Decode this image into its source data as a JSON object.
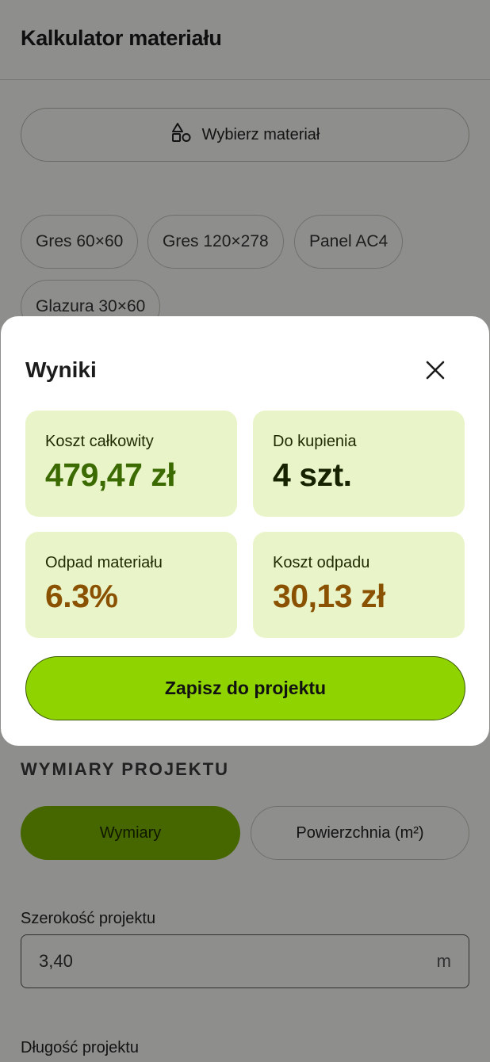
{
  "appbar": {
    "title": "Kalkulator materiału"
  },
  "material_button": {
    "label": "Wybierz materiał",
    "icon": "shapes-icon"
  },
  "chips": [
    "Gres 60×60",
    "Gres 120×278",
    "Panel AC4",
    "Glazura 30×60"
  ],
  "dimensions": {
    "section_title": "WYMIARY PROJEKTU",
    "modes": [
      "Wymiary",
      "Powierzchnia (m²)"
    ],
    "width_label": "Szerokość projektu",
    "width_value": "3,40",
    "width_unit": "m",
    "length_label": "Długość projektu"
  },
  "dialog": {
    "title": "Wyniki",
    "close_icon": "close-icon",
    "results": [
      {
        "label": "Koszt całkowity",
        "value": "479,47 zł",
        "color": "#3b6a00"
      },
      {
        "label": "Do kupienia",
        "value": "4 szt.",
        "color": "#162200"
      },
      {
        "label": "Odpad materiału",
        "value": "6.3%",
        "color": "#8a5200"
      },
      {
        "label": "Koszt odpadu",
        "value": "30,13 zł",
        "color": "#8a5200"
      }
    ],
    "save_label": "Zapisz do projektu"
  },
  "colors": {
    "accent": "#8fd400",
    "segment_active": "#7cb300",
    "card_bg": "#e9f5c9"
  }
}
